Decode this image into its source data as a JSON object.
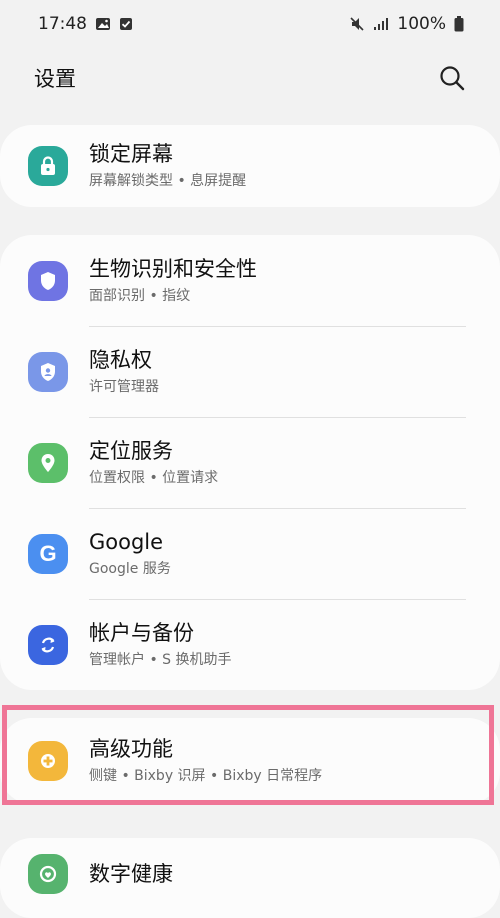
{
  "status": {
    "time": "17:48",
    "battery": "100%"
  },
  "header": {
    "title": "设置"
  },
  "icons": {
    "search": "search-icon",
    "lock": "lock-icon",
    "shield": "shield-icon",
    "privacy": "privacy-shield-icon",
    "location": "location-pin-icon",
    "google": "google-g-icon",
    "sync": "sync-icon",
    "advanced": "plus-gear-icon",
    "wellbeing": "heart-icon"
  },
  "colors": {
    "lock": "#2aa99a",
    "biometrics": "#6f74e3",
    "privacy": "#7a97e8",
    "location": "#5cbf6a",
    "google": "#4b8ff0",
    "accounts": "#3b66e0",
    "advanced": "#f3b73b",
    "wellbeing": "#56b36e",
    "highlight": "#ef7596"
  },
  "items": {
    "lock_screen": {
      "title": "锁定屏幕",
      "sub": "屏幕解锁类型 • 息屏提醒"
    },
    "biometrics": {
      "title": "生物识别和安全性",
      "sub": "面部识别 • 指纹"
    },
    "privacy": {
      "title": "隐私权",
      "sub": "许可管理器"
    },
    "location": {
      "title": "定位服务",
      "sub": "位置权限 • 位置请求"
    },
    "google": {
      "title": "Google",
      "sub": "Google 服务"
    },
    "accounts": {
      "title": "帐户与备份",
      "sub": "管理帐户 • S 换机助手"
    },
    "advanced": {
      "title": "高级功能",
      "sub": "侧键 • Bixby 识屏 • Bixby 日常程序"
    },
    "wellbeing": {
      "title": "数字健康"
    }
  }
}
